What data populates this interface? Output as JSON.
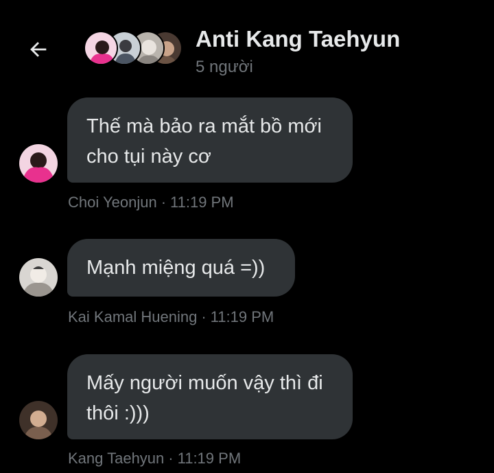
{
  "header": {
    "title": "Anti Kang Taehyun",
    "subtitle": "5 người"
  },
  "icons": {
    "back": "arrow-left-icon"
  },
  "colors": {
    "background": "#000000",
    "bubble": "#2f3336",
    "text": "#e7e9ea",
    "muted": "#71767b"
  },
  "messages": [
    {
      "text": "Thế mà bảo ra mắt bồ mới cho tụi này cơ",
      "sender": "Choi Yeonjun",
      "time": "11:19 PM",
      "separator": "·"
    },
    {
      "text": "Mạnh miệng quá =))",
      "sender": "Kai Kamal Huening",
      "time": "11:19 PM",
      "separator": "·"
    },
    {
      "text": "Mấy người muốn vậy thì đi thôi :)))",
      "sender": "Kang Taehyun",
      "time": "11:19 PM",
      "separator": "·"
    }
  ]
}
